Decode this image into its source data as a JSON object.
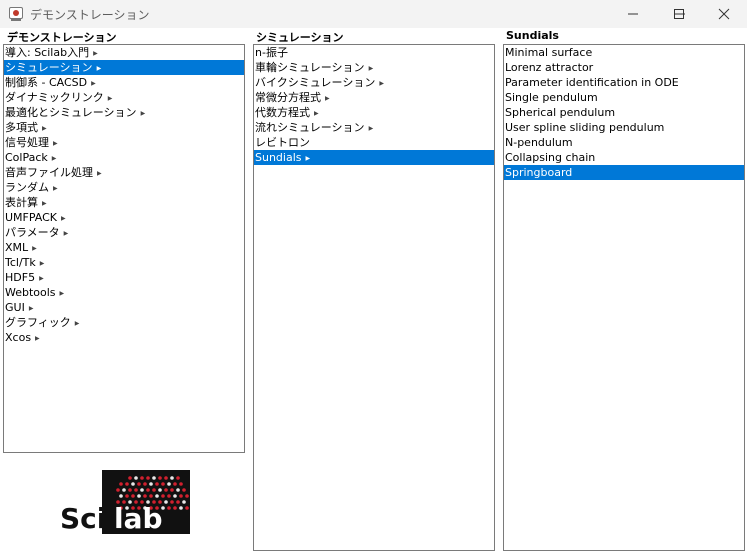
{
  "window": {
    "title": "デモンストレーション"
  },
  "columns": [
    {
      "title": "デモンストレーション",
      "items": [
        {
          "label": "導入: Scilab入門",
          "arrow": true
        },
        {
          "label": "シミュレーション",
          "arrow": true,
          "selected": true
        },
        {
          "label": "制御系 - CACSD",
          "arrow": true
        },
        {
          "label": "ダイナミックリンク",
          "arrow": true
        },
        {
          "label": "最適化とシミュレーション",
          "arrow": true
        },
        {
          "label": "多項式",
          "arrow": true
        },
        {
          "label": "信号処理",
          "arrow": true
        },
        {
          "label": "ColPack",
          "arrow": true
        },
        {
          "label": "音声ファイル処理",
          "arrow": true
        },
        {
          "label": "ランダム",
          "arrow": true
        },
        {
          "label": "表計算",
          "arrow": true
        },
        {
          "label": "UMFPACK",
          "arrow": true
        },
        {
          "label": "パラメータ",
          "arrow": true
        },
        {
          "label": "XML",
          "arrow": true
        },
        {
          "label": "Tcl/Tk",
          "arrow": true
        },
        {
          "label": "HDF5",
          "arrow": true
        },
        {
          "label": "Webtools",
          "arrow": true
        },
        {
          "label": "GUI",
          "arrow": true
        },
        {
          "label": "グラフィック",
          "arrow": true
        },
        {
          "label": "Xcos",
          "arrow": true
        }
      ]
    },
    {
      "title": "シミュレーション",
      "items": [
        {
          "label": "n-振子",
          "arrow": false
        },
        {
          "label": "車輪シミュレーション",
          "arrow": true
        },
        {
          "label": "バイクシミュレーション",
          "arrow": true
        },
        {
          "label": "常微分方程式",
          "arrow": true
        },
        {
          "label": "代数方程式",
          "arrow": true
        },
        {
          "label": "流れシミュレーション",
          "arrow": true
        },
        {
          "label": "レビトロン",
          "arrow": false
        },
        {
          "label": "Sundials",
          "arrow": true,
          "selected": true
        }
      ]
    },
    {
      "title": "Sundials",
      "items": [
        {
          "label": "Minimal surface",
          "arrow": false
        },
        {
          "label": "Lorenz attractor",
          "arrow": false
        },
        {
          "label": "Parameter identification in ODE",
          "arrow": false
        },
        {
          "label": "Single pendulum",
          "arrow": false
        },
        {
          "label": "Spherical pendulum",
          "arrow": false
        },
        {
          "label": "User spline sliding pendulum",
          "arrow": false
        },
        {
          "label": "N-pendulum",
          "arrow": false
        },
        {
          "label": "Collapsing chain",
          "arrow": false
        },
        {
          "label": "Springboard",
          "arrow": false,
          "selected": true
        }
      ]
    }
  ],
  "logo": {
    "text": "Scilab"
  },
  "colors": {
    "selection": "#0078d7",
    "titlebar": "#f3f3f3"
  }
}
